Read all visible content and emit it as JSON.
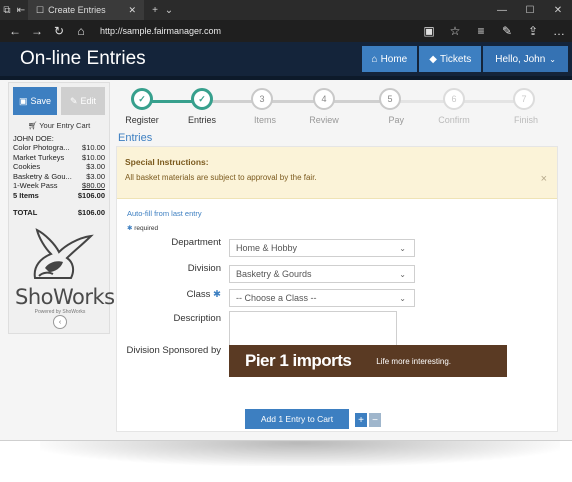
{
  "browser": {
    "tab_title": "Create Entries",
    "url": "http://sample.fairmanager.com"
  },
  "app": {
    "title": "On-line Entries",
    "home_label": "Home",
    "tickets_label": "Tickets",
    "user_label": "Hello, John"
  },
  "sidebar": {
    "save_label": "Save",
    "edit_label": "Edit",
    "cart_heading": "Your Entry Cart",
    "cart_name": "JOHN DOE:",
    "items": [
      {
        "name": "Color Photogra...",
        "amount": "$10.00"
      },
      {
        "name": "Market Turkeys",
        "amount": "$10.00"
      },
      {
        "name": "Cookies",
        "amount": "$3.00"
      },
      {
        "name": "Basketry & Gou...",
        "amount": "$3.00"
      },
      {
        "name": "1-Week Pass",
        "amount": "$80.00"
      }
    ],
    "count_label": "5 Items",
    "subtotal": "$106.00",
    "total_label": "TOTAL",
    "total": "$106.00",
    "logo_text": "ShoWorks",
    "logo_sub": "Powered by ShoWorks"
  },
  "steps": [
    {
      "label": "Register",
      "number": "",
      "state": "done"
    },
    {
      "label": "Entries",
      "number": "",
      "state": "done"
    },
    {
      "label": "Items",
      "number": "3",
      "state": "todo"
    },
    {
      "label": "Review",
      "number": "4",
      "state": "todo"
    },
    {
      "label": "Pay",
      "number": "5",
      "state": "todo"
    },
    {
      "label": "Confirm",
      "number": "6",
      "state": "far"
    },
    {
      "label": "Finish",
      "number": "7",
      "state": "far"
    }
  ],
  "main": {
    "section_title": "Entries",
    "notice_title": "Special Instructions:",
    "notice_text": "All basket materials are subject to approval by the fair.",
    "notice_close": "×",
    "autofill": "Auto-fill from last entry",
    "required": "required",
    "department_label": "Department",
    "department_value": "Home & Hobby",
    "division_label": "Division",
    "division_value": "Basketry & Gourds",
    "class_label": "Class",
    "class_value": "-- Choose a Class --",
    "description_label": "Description",
    "sponsor_label": "Division Sponsored by",
    "sponsor_brand": "Pier 1 imports",
    "sponsor_tagline": "Life more interesting.",
    "add_button": "Add 1 Entry to Cart",
    "plus": "+",
    "minus": "−"
  },
  "colors": {
    "header": "#14243a",
    "accent": "#3d7fc1",
    "step_done": "#37a08d",
    "notice_bg": "#fbf3d8",
    "sponsor_bg": "#5a3a23"
  }
}
